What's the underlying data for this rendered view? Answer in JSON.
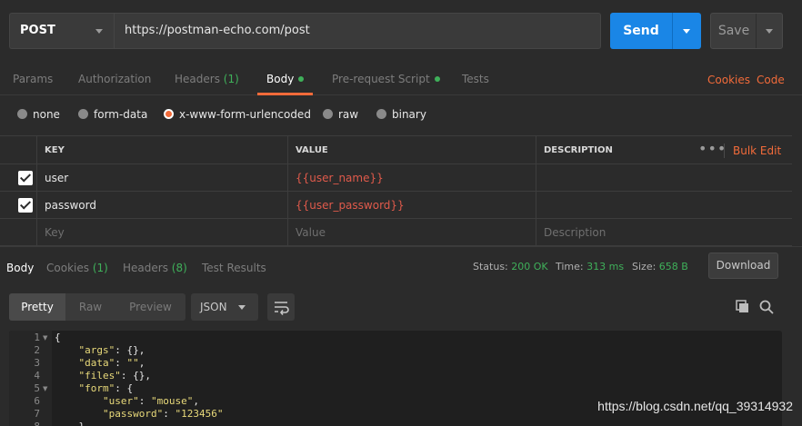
{
  "request": {
    "method": "POST",
    "url": "https://postman-echo.com/post",
    "send_label": "Send",
    "save_label": "Save"
  },
  "request_tabs": [
    {
      "label": "Params"
    },
    {
      "label": "Authorization"
    },
    {
      "label": "Headers",
      "count": "(1)"
    },
    {
      "label": "Body",
      "active": true
    },
    {
      "label": "Pre-request Script"
    },
    {
      "label": "Tests"
    }
  ],
  "links": {
    "cookies": "Cookies",
    "code": "Code"
  },
  "body_types": [
    {
      "label": "none"
    },
    {
      "label": "form-data"
    },
    {
      "label": "x-www-form-urlencoded",
      "selected": true
    },
    {
      "label": "raw"
    },
    {
      "label": "binary"
    }
  ],
  "params_table": {
    "headers": {
      "key": "KEY",
      "value": "VALUE",
      "description": "DESCRIPTION"
    },
    "bulk_edit": "Bulk Edit",
    "more": "•••",
    "rows": [
      {
        "key": "user",
        "value": "{{user_name}}",
        "checked": true
      },
      {
        "key": "password",
        "value": "{{user_password}}",
        "checked": true
      }
    ],
    "placeholders": {
      "key": "Key",
      "value": "Value",
      "description": "Description"
    }
  },
  "response_tabs": [
    {
      "label": "Body",
      "active": true
    },
    {
      "label": "Cookies",
      "count": "(1)"
    },
    {
      "label": "Headers",
      "count": "(8)"
    },
    {
      "label": "Test Results"
    }
  ],
  "response_meta": {
    "status_label": "Status:",
    "status_value": "200 OK",
    "time_label": "Time:",
    "time_value": "313 ms",
    "size_label": "Size:",
    "size_value": "658 B",
    "download_label": "Download"
  },
  "response_view": {
    "modes": [
      "Pretty",
      "Raw",
      "Preview"
    ],
    "format": "JSON"
  },
  "code_lines": [
    {
      "n": "1",
      "fold": true,
      "text": "{"
    },
    {
      "n": "2",
      "text": "    \"args\": {},"
    },
    {
      "n": "3",
      "text": "    \"data\": \"\","
    },
    {
      "n": "4",
      "text": "    \"files\": {},"
    },
    {
      "n": "5",
      "fold": true,
      "text": "    \"form\": {"
    },
    {
      "n": "6",
      "text": "        \"user\": \"mouse\","
    },
    {
      "n": "7",
      "text": "        \"password\": \"123456\""
    },
    {
      "n": "8",
      "text": "    },"
    }
  ],
  "watermark": "https://blog.csdn.net/qq_39314932",
  "colors": {
    "accent": "#f26b3a",
    "primary": "#1a86e6",
    "success": "#3fb05a",
    "variable": "#e05a4b"
  }
}
